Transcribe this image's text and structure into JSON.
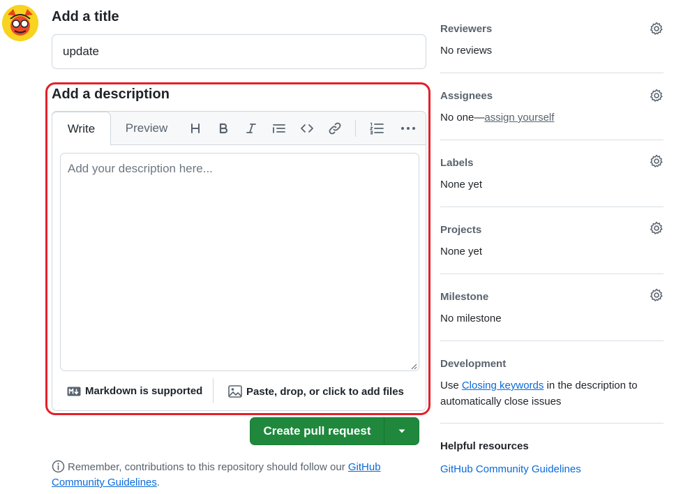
{
  "form": {
    "title_label": "Add a title",
    "title_value": "update",
    "description_label": "Add a description"
  },
  "editor": {
    "tabs": [
      {
        "label": "Write",
        "active": true
      },
      {
        "label": "Preview",
        "active": false
      }
    ],
    "toolbar_icons": [
      "heading-icon",
      "bold-icon",
      "italic-icon",
      "quote-icon",
      "code-icon",
      "link-icon",
      "numbered-list-icon",
      "more-options-icon"
    ],
    "placeholder": "Add your description here...",
    "markdown_note": "Markdown is supported",
    "attach_label": "Paste, drop, or click to add files"
  },
  "actions": {
    "create_label": "Create pull request",
    "accent_color": "#1f883d"
  },
  "guideline": {
    "text": "Remember, contributions to this repository should follow our ",
    "link": "GitHub Community Guidelines",
    "end": "."
  },
  "sidebar": {
    "reviewers": {
      "heading": "Reviewers",
      "value": "No reviews"
    },
    "assignees": {
      "heading": "Assignees",
      "prefix": "No one—",
      "link": "assign yourself"
    },
    "labels": {
      "heading": "Labels",
      "value": "None yet"
    },
    "projects": {
      "heading": "Projects",
      "value": "None yet"
    },
    "milestone": {
      "heading": "Milestone",
      "value": "No milestone"
    },
    "development": {
      "heading": "Development",
      "text_before": "Use ",
      "link": "Closing keywords",
      "text_after": " in the description to automatically close issues"
    },
    "resources": {
      "heading": "Helpful resources",
      "link": "GitHub Community Guidelines"
    }
  },
  "highlight_color": "#e3202a"
}
